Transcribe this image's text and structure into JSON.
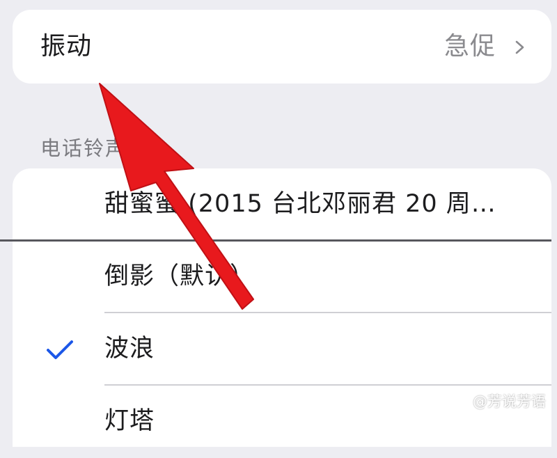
{
  "vibration": {
    "label": "振动",
    "value": "急促",
    "chevron_icon": "chevron-right-icon"
  },
  "ringtones": {
    "section_title": "电话铃声",
    "items": [
      {
        "label": "甜蜜蜜 (2015 台北邓丽君 20 周…",
        "selected": false
      },
      {
        "label": "倒影（默认）",
        "selected": false
      },
      {
        "label": "波浪",
        "selected": true
      },
      {
        "label": "灯塔",
        "selected": false
      }
    ],
    "check_icon": "checkmark-icon"
  },
  "annotation": {
    "arrow_icon": "red-arrow-icon",
    "arrow_color": "#e8191d"
  },
  "watermark": {
    "text": "@芳说芳语"
  },
  "colors": {
    "background": "#ededf2",
    "card": "#ffffff",
    "secondary_text": "#8a8a8e",
    "accent": "#1c57e8"
  }
}
